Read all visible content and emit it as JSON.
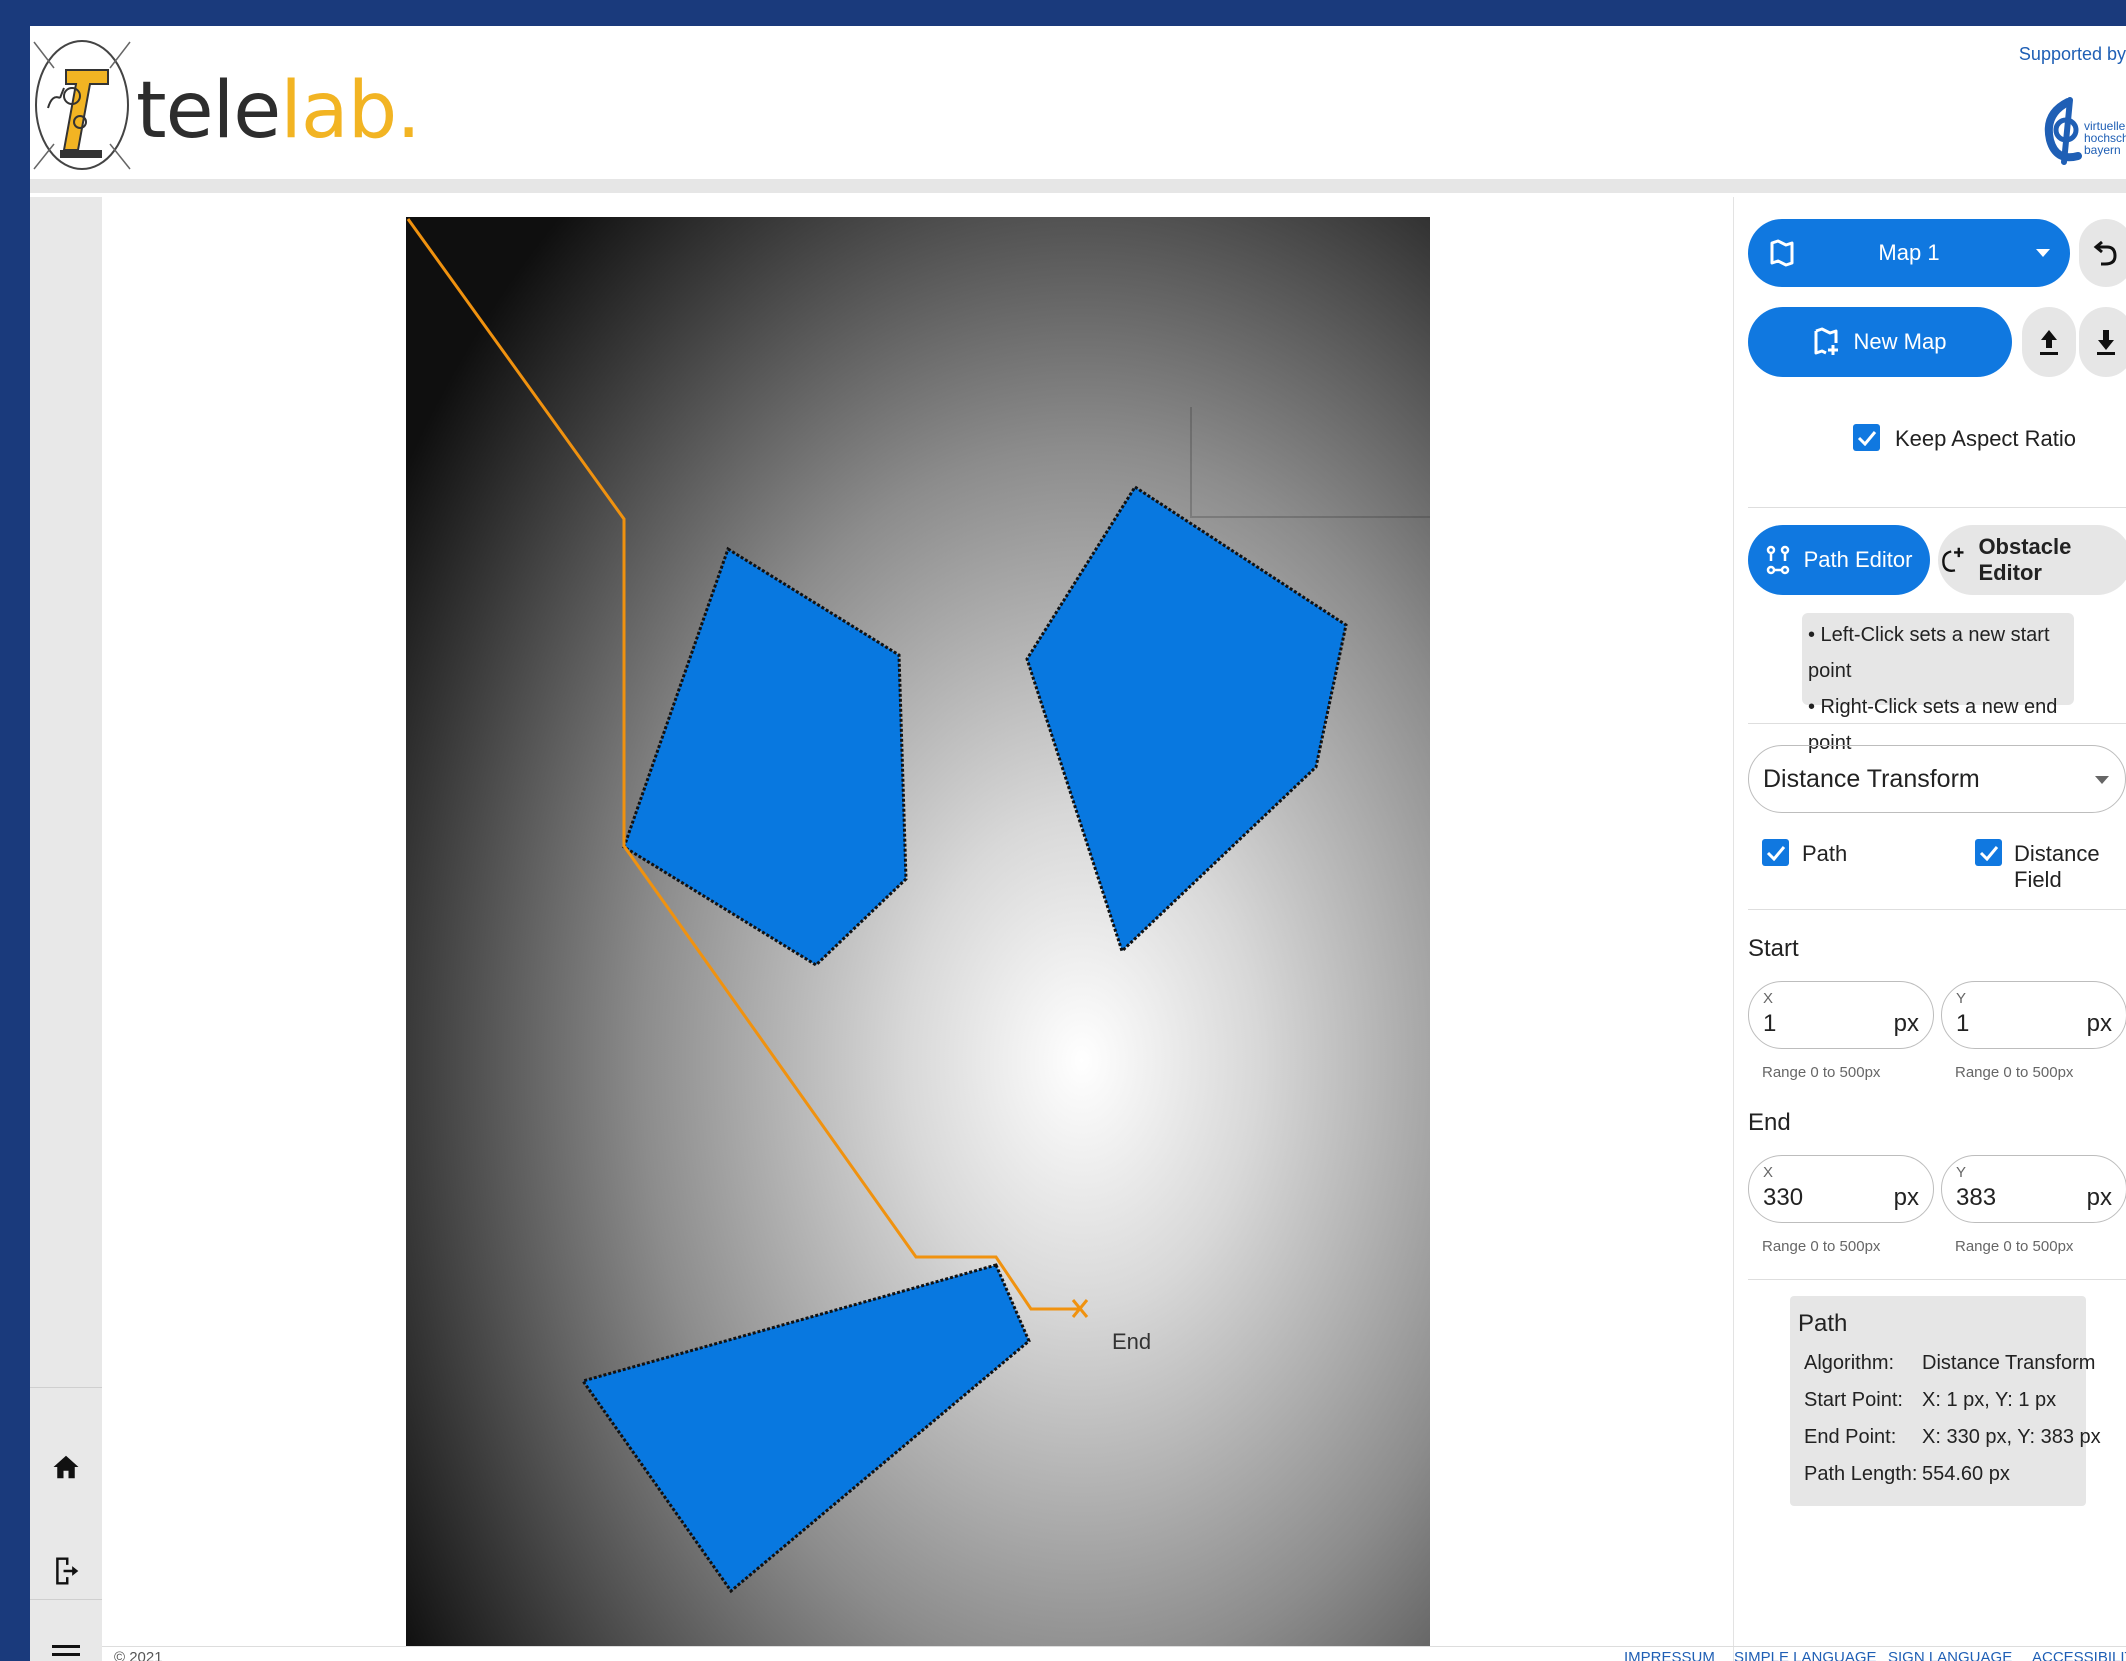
{
  "header": {
    "brand_part1": "tele",
    "brand_part2": "lab.",
    "supported_by": "Supported by",
    "sponsor_text_line1": "virtuelle",
    "sponsor_text_line2": "hochschule",
    "sponsor_text_line3": "bayern"
  },
  "nav": {
    "icons": [
      "home-icon",
      "logout-icon",
      "menu-icon"
    ]
  },
  "map": {
    "end_label": "End",
    "path_color": "#f0920f",
    "obstacle_color": "#0878e0"
  },
  "panel": {
    "map_select": "Map 1",
    "new_map": "New Map",
    "keep_aspect_ratio": "Keep Aspect Ratio",
    "keep_aspect_ratio_checked": true,
    "path_editor": "Path Editor",
    "obstacle_editor": "Obstacle Editor",
    "hint_line1": "• Left-Click sets a new start point",
    "hint_line2": "• Right-Click sets a new end point",
    "algorithm_select": "Distance Transform",
    "path_checkbox": "Path",
    "path_checked": true,
    "distance_field_checkbox": "Distance Field",
    "distance_field_checked": true,
    "start_label": "Start",
    "end_label": "End",
    "x_label": "X",
    "y_label": "Y",
    "unit": "px",
    "range_helper": "Range 0 to 500px",
    "start_x": "1",
    "start_y": "1",
    "end_x": "330",
    "end_y": "383"
  },
  "path_info": {
    "title": "Path",
    "algorithm_key": "Algorithm:",
    "algorithm_val": "Distance Transform",
    "start_key": "Start Point:",
    "start_val": "X: 1 px, Y: 1 px",
    "end_key": "End Point:",
    "end_val": "X: 330 px, Y: 383 px",
    "length_key": "Path Length:",
    "length_val": "554.60 px"
  },
  "footer": {
    "copyright": "© 2021",
    "links": [
      "IMPRESSUM",
      "SIMPLE LANGUAGE",
      "SIGN LANGUAGE",
      "ACCESSIBILIT"
    ]
  },
  "colors": {
    "frame": "#1a3a7c",
    "accent": "#1078e0",
    "brand_yellow": "#f2b423"
  }
}
